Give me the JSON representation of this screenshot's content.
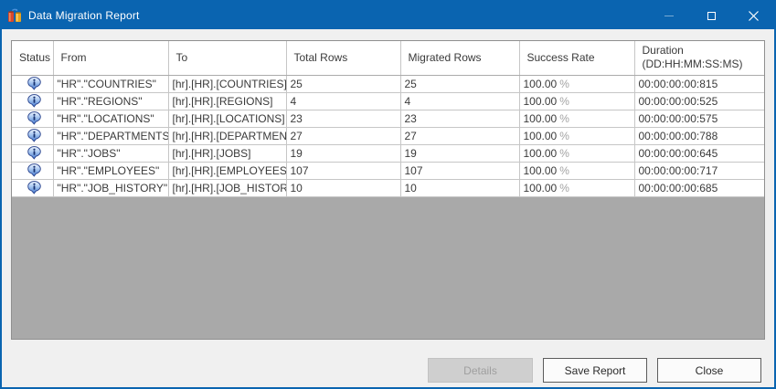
{
  "window": {
    "title": "Data Migration Report"
  },
  "colors": {
    "titlebar_blue": "#0a64b0",
    "window_border_blue": "#0a64b0",
    "grid_empty_gray": "#a9a9a9",
    "status_icon_blue": "#3f74cc",
    "success_unit_gray": "#a3a3a3"
  },
  "icons": {
    "app": "data-migration-jars-icon",
    "minimize": "minimize-dash",
    "maximize": "maximize-square",
    "close": "close-x",
    "row_status": "info-balloon-icon"
  },
  "table": {
    "columns": [
      {
        "label": "Status"
      },
      {
        "label": "From"
      },
      {
        "label": "To"
      },
      {
        "label": "Total Rows"
      },
      {
        "label": "Migrated Rows"
      },
      {
        "label": "Success Rate"
      },
      {
        "label": "Duration",
        "label2": "(DD:HH:MM:SS:MS)"
      }
    ],
    "rows": [
      {
        "from": "\"HR\".\"COUNTRIES\"",
        "to": "[hr].[HR].[COUNTRIES]",
        "total_rows": "25",
        "migrated_rows": "25",
        "success_value": "100.00",
        "success_unit": "%",
        "duration": "00:00:00:00:815"
      },
      {
        "from": "\"HR\".\"REGIONS\"",
        "to": "[hr].[HR].[REGIONS]",
        "total_rows": "4",
        "migrated_rows": "4",
        "success_value": "100.00",
        "success_unit": "%",
        "duration": "00:00:00:00:525"
      },
      {
        "from": "\"HR\".\"LOCATIONS\"",
        "to": "[hr].[HR].[LOCATIONS]",
        "total_rows": "23",
        "migrated_rows": "23",
        "success_value": "100.00",
        "success_unit": "%",
        "duration": "00:00:00:00:575"
      },
      {
        "from": "\"HR\".\"DEPARTMENTS\"",
        "to": "[hr].[HR].[DEPARTMENTS]",
        "total_rows": "27",
        "migrated_rows": "27",
        "success_value": "100.00",
        "success_unit": "%",
        "duration": "00:00:00:00:788"
      },
      {
        "from": "\"HR\".\"JOBS\"",
        "to": "[hr].[HR].[JOBS]",
        "total_rows": "19",
        "migrated_rows": "19",
        "success_value": "100.00",
        "success_unit": "%",
        "duration": "00:00:00:00:645"
      },
      {
        "from": "\"HR\".\"EMPLOYEES\"",
        "to": "[hr].[HR].[EMPLOYEES]",
        "total_rows": "107",
        "migrated_rows": "107",
        "success_value": "100.00",
        "success_unit": "%",
        "duration": "00:00:00:00:717"
      },
      {
        "from": "\"HR\".\"JOB_HISTORY\"",
        "to": "[hr].[HR].[JOB_HISTORY]",
        "total_rows": "10",
        "migrated_rows": "10",
        "success_value": "100.00",
        "success_unit": "%",
        "duration": "00:00:00:00:685"
      }
    ]
  },
  "footer": {
    "details_label": "Details",
    "save_report_label": "Save Report",
    "close_label": "Close"
  }
}
